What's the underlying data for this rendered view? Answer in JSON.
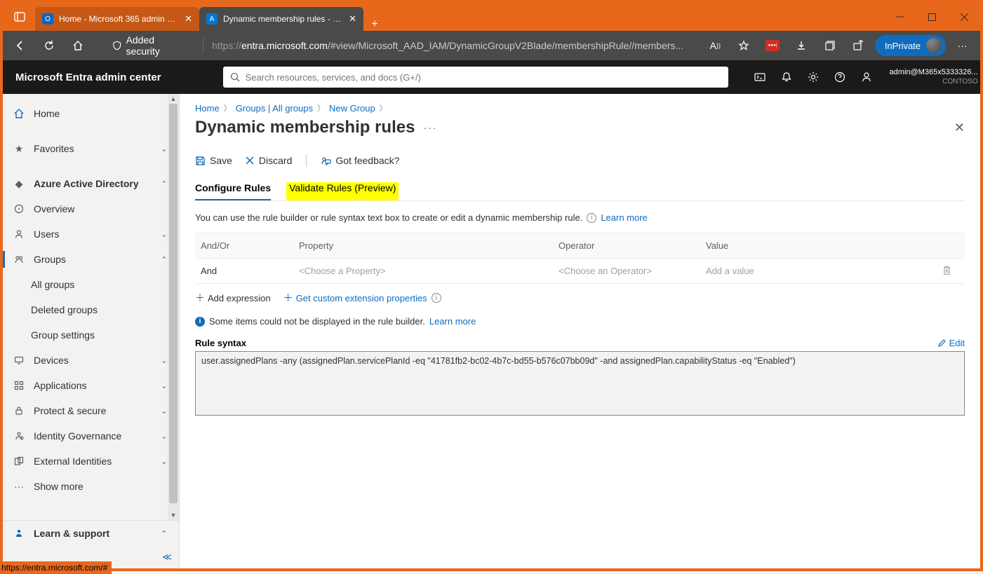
{
  "browser": {
    "tabs": [
      {
        "title": "Home - Microsoft 365 admin cen",
        "active": false
      },
      {
        "title": "Dynamic membership rules - Mic",
        "active": true
      }
    ],
    "security_label": "Added security",
    "url_proto": "https://",
    "url_host": "entra.microsoft.com",
    "url_path": "/#view/Microsoft_AAD_IAM/DynamicGroupV2Blade/membershipRule//members...",
    "inprivate_label": "InPrivate",
    "status_url": "https://entra.microsoft.com/#"
  },
  "portal": {
    "title": "Microsoft Entra admin center",
    "search_placeholder": "Search resources, services, and docs (G+/)",
    "user_email": "admin@M365x5333326...",
    "user_org": "CONTOSO"
  },
  "sidebar": {
    "home": "Home",
    "favorites": "Favorites",
    "aad": "Azure Active Directory",
    "overview": "Overview",
    "users": "Users",
    "groups": "Groups",
    "all_groups": "All groups",
    "deleted_groups": "Deleted groups",
    "group_settings": "Group settings",
    "devices": "Devices",
    "applications": "Applications",
    "protect": "Protect & secure",
    "identity_gov": "Identity Governance",
    "ext_ident": "External Identities",
    "show_more": "Show more",
    "learn": "Learn & support"
  },
  "breadcrumb": {
    "home": "Home",
    "groups": "Groups | All groups",
    "new_group": "New Group"
  },
  "page": {
    "title": "Dynamic membership rules",
    "save": "Save",
    "discard": "Discard",
    "feedback": "Got feedback?",
    "tab_configure": "Configure Rules",
    "tab_validate": "Validate Rules (Preview)",
    "desc": "You can use the rule builder or rule syntax text box to create or edit a dynamic membership rule.",
    "learn_more": "Learn more",
    "col_andor": "And/Or",
    "col_property": "Property",
    "col_operator": "Operator",
    "col_value": "Value",
    "row_andor": "And",
    "row_property": "<Choose a Property>",
    "row_operator": "<Choose an Operator>",
    "row_value": "Add a value",
    "add_expression": "Add expression",
    "get_custom": "Get custom extension properties",
    "info_text": "Some items could not be displayed in the rule builder.",
    "info_learn": "Learn more",
    "rule_syntax_label": "Rule syntax",
    "edit": "Edit",
    "rule_syntax_value": "user.assignedPlans -any (assignedPlan.servicePlanId -eq \"41781fb2-bc02-4b7c-bd55-b576c07bb09d\" -and assignedPlan.capabilityStatus -eq \"Enabled\")"
  }
}
